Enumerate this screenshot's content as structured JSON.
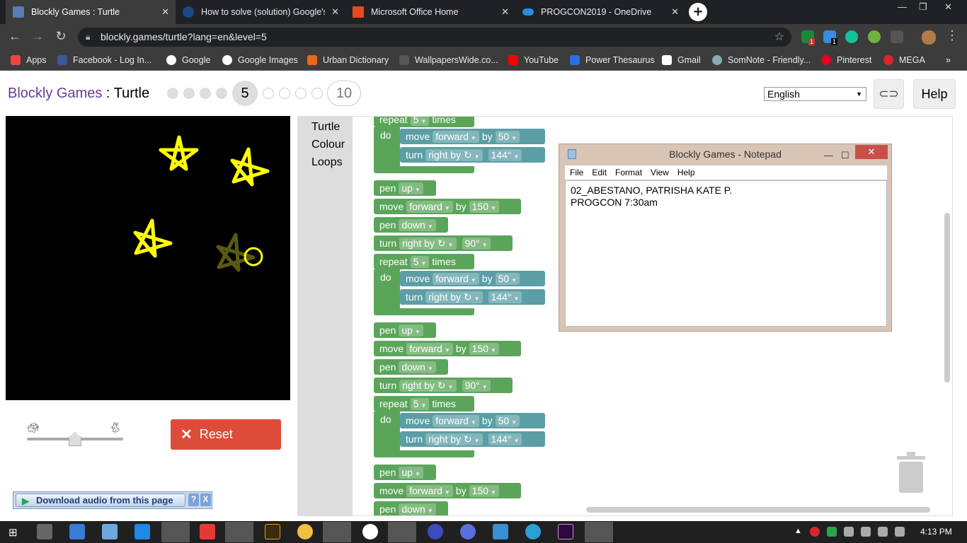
{
  "browser": {
    "tabs": [
      {
        "title": "Blockly Games : Turtle",
        "active": true
      },
      {
        "title": "How to solve (solution) Google's",
        "active": false
      },
      {
        "title": "Microsoft Office Home",
        "active": false
      },
      {
        "title": "PROGCON2019 - OneDrive",
        "active": false
      }
    ],
    "url": "blockly.games/turtle?lang=en&level=5",
    "bookmarks": [
      "Apps",
      "Facebook - Log In...",
      "Google",
      "Google Images",
      "Urban Dictionary",
      "WallpapersWide.co...",
      "YouTube",
      "Power Thesaurus",
      "Gmail",
      "SomNote - Friendly...",
      "Pinterest",
      "MEGA"
    ],
    "extension_badges": [
      "1",
      "1"
    ]
  },
  "game": {
    "brand": "Blockly Games",
    "separator": " : ",
    "name": "Turtle",
    "current_level": "5",
    "max_level": "10",
    "language": "English",
    "help_label": "Help",
    "reset_label": "Reset",
    "speed_fraction": 0.5
  },
  "toolbox": [
    "Turtle",
    "Colour",
    "Loops"
  ],
  "blocks": {
    "repeat": "repeat",
    "times": "times",
    "do": "do",
    "move": "move",
    "forward": "forward",
    "by": "by",
    "turn": "turn",
    "right_by": "right by ↻",
    "pen": "pen",
    "up": "up",
    "down": "down",
    "count": "5",
    "step": "50",
    "angle": "144°",
    "long_step": "150",
    "turn_angle": "90°"
  },
  "download_bar": {
    "label": "Download audio from this page",
    "help": "?",
    "close": "X"
  },
  "notepad": {
    "title": "Blockly Games - Notepad",
    "menu": [
      "File",
      "Edit",
      "Format",
      "View",
      "Help"
    ],
    "lines": [
      "02_ABESTANO, PATRISHA KATE P.",
      "PROGCON 7:30am"
    ]
  },
  "taskbar": {
    "time": "4:13 PM"
  },
  "colors": {
    "accent_purple": "#6a3a9a",
    "block_green": "#5ba55b",
    "block_teal": "#5b9ea5",
    "reset_red": "#dd4b39",
    "star_yellow": "#ffff00"
  }
}
